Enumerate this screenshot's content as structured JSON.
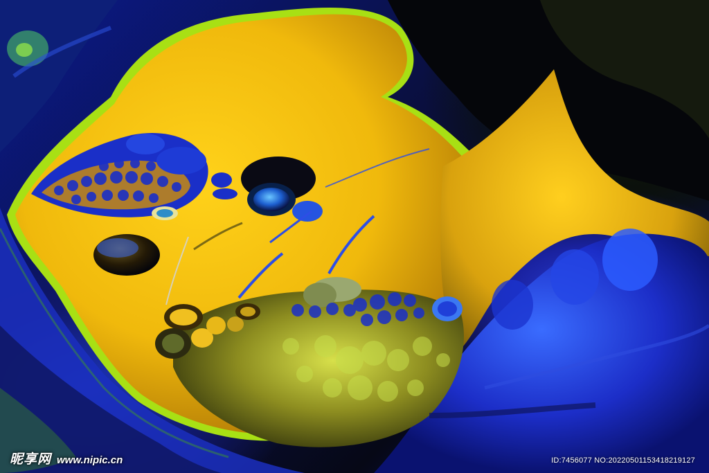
{
  "image": {
    "description": "Abstract fluid acrylic pour painting with yellow, blue and dark green cells",
    "palette": {
      "gold": "#f2c20f",
      "amber": "#d89a0a",
      "royal_blue": "#1a2ccc",
      "deep_navy": "#0a0f3e",
      "olive": "#8e8a1c",
      "lime": "#b8e61a",
      "black": "#05060a"
    }
  },
  "watermark": {
    "logo_text": "昵享网",
    "site": "www.nipic.cn",
    "id_text": "ID:7456077 NO:20220501153418219127"
  }
}
